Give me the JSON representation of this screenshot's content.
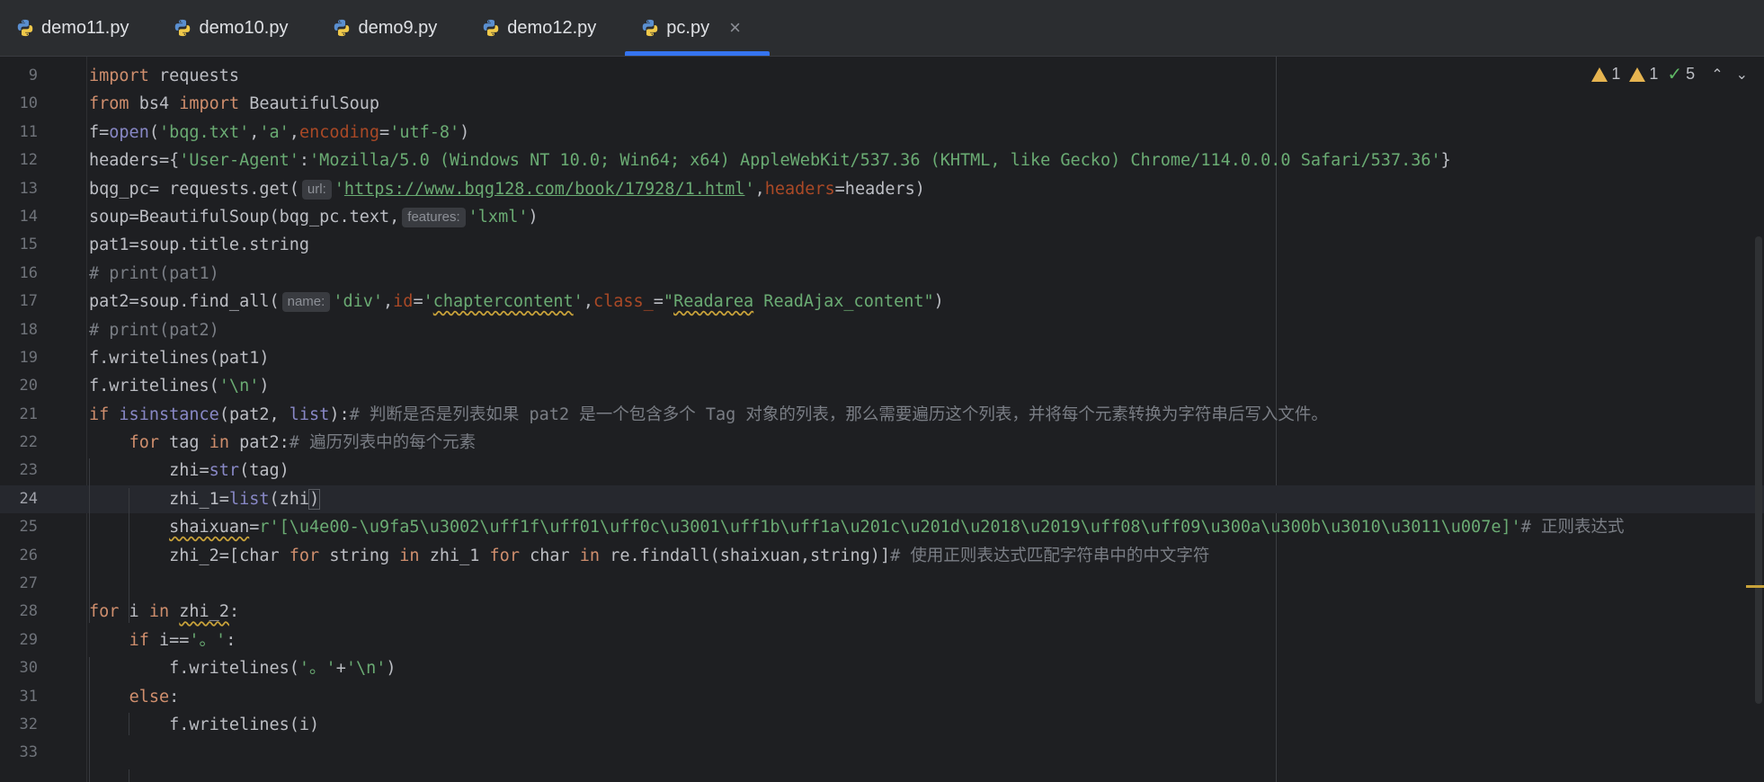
{
  "tabs": [
    {
      "label": "demo11.py",
      "active": false
    },
    {
      "label": "demo10.py",
      "active": false
    },
    {
      "label": "demo9.py",
      "active": false
    },
    {
      "label": "demo12.py",
      "active": false
    },
    {
      "label": "pc.py",
      "active": true
    }
  ],
  "tab_close_glyph": "×",
  "inspections": {
    "warnings": "1",
    "weak_warnings": "1",
    "ok": "5"
  },
  "line_numbers": [
    "9",
    "10",
    "11",
    "12",
    "13",
    "14",
    "15",
    "16",
    "17",
    "18",
    "19",
    "20",
    "21",
    "22",
    "23",
    "24",
    "25",
    "26",
    "27",
    "28",
    "29",
    "30",
    "31",
    "32",
    "33"
  ],
  "hints": {
    "url": "url:",
    "features": "features:",
    "name": "name:"
  },
  "code_strings": {
    "l12_ua": "'Mozilla/5.0 (Windows NT 10.0; Win64; x64) AppleWebKit/537.36 (KHTML, like Gecko) Chrome/114.0.0.0 Safari/537.36'",
    "l13_url": "https://www.bqg128.com/book/17928/1.html",
    "l21_comment": "# 判断是否是列表如果 pat2 是一个包含多个 Tag 对象的列表，那么需要遍历这个列表，并将每个元素转换为字符串后写入文件。",
    "l22_comment": "# 遍历列表中的每个元素",
    "l25_regex": "r'[\\u4e00-\\u9fa5\\u3002\\uff1f\\uff01\\uff0c\\u3001\\uff1b\\uff1a\\u201c\\u201d\\u2018\\u2019\\uff08\\uff09\\u300a\\u300b\\u3010\\u3011\\u007e]'",
    "l25_comment": "# 正则表达式",
    "l26_comment": "# 使用正则表达式匹配字符串中的中文字符"
  },
  "colors": {
    "background": "#1e1f22",
    "tab_bar": "#2b2d30",
    "active_tab_underline": "#3574f0",
    "keyword": "#cf8e6d",
    "string": "#6aab73",
    "comment": "#7a7e85",
    "builtin": "#8888c6",
    "warning": "#e6b450"
  }
}
